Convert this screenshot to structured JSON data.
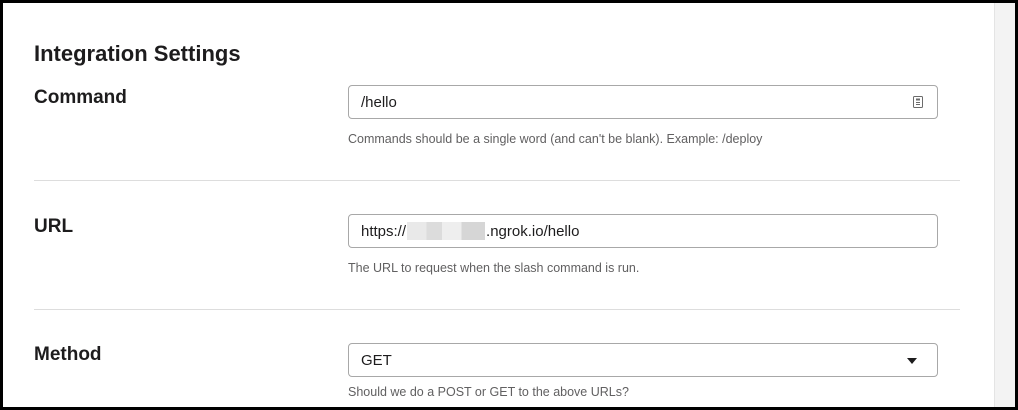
{
  "section": {
    "title": "Integration Settings"
  },
  "command": {
    "label": "Command",
    "value": "/hello",
    "hint": "Commands should be a single word (and can't be blank). Example: /deploy",
    "icon": "clipboard-icon"
  },
  "url": {
    "label": "URL",
    "value_prefix": "https://",
    "value_suffix": ".ngrok.io/hello",
    "hint": "The URL to request when the slash command is run."
  },
  "method": {
    "label": "Method",
    "selected": "GET",
    "hint": "Should we do a POST or GET to the above URLs?",
    "icon": "caret-down-icon"
  },
  "colors": {
    "text": "#1d1c1d",
    "hint": "#616061",
    "border": "#a8a8a8",
    "divider": "#dddddd"
  }
}
